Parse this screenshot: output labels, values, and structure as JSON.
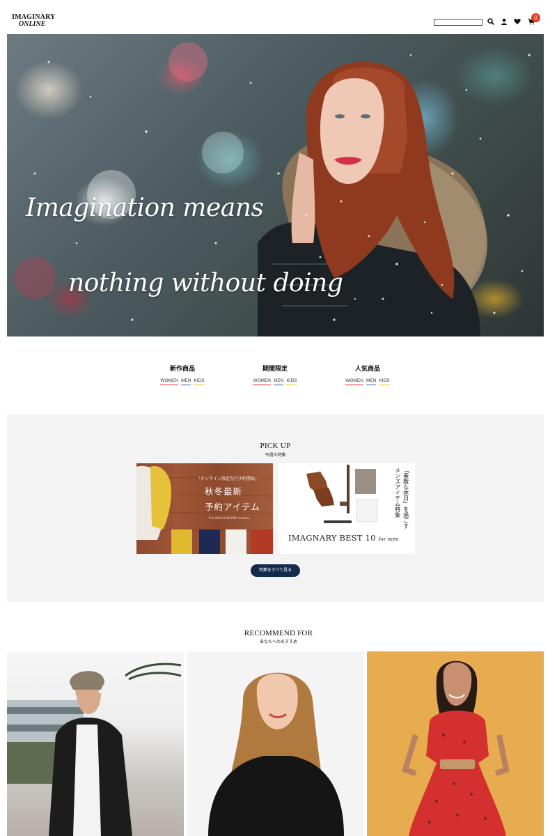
{
  "header": {
    "logo_top": "IMAGINARY",
    "logo_bottom": "ONLINE",
    "search_placeholder": "",
    "icons": [
      "search-icon",
      "user-icon",
      "heart-icon",
      "cart-icon"
    ],
    "cart_count": "0"
  },
  "hero": {
    "line1": "Imagination means",
    "line2": "nothing without doing"
  },
  "categories": [
    {
      "title": "新作商品",
      "links": [
        "WOMEN",
        "MEN",
        "KIDS"
      ]
    },
    {
      "title": "期間限定",
      "links": [
        "WOMEN",
        "MEN",
        "KIDS"
      ]
    },
    {
      "title": "人気商品",
      "links": [
        "WOMEN",
        "MEN",
        "KIDS"
      ]
    }
  ],
  "pickup": {
    "title": "PICK UP",
    "subtitle": "今週の特集",
    "banner1": {
      "small": "「オンライン限定先行予約開始」",
      "line1": "秋冬最新",
      "line2": "予約アイテム",
      "tiny": "For IMAGINARY women"
    },
    "banner2": {
      "caption_main": "IMAGNARY BEST 10",
      "caption_small": "for men",
      "vertical1": "「素敵な休日」を過ごす",
      "vertical2": "メンズアイテム特集"
    },
    "button_label": "特集をすべて見る"
  },
  "recommend": {
    "title": "RECOMMEND FOR",
    "subtitle": "あなたへのおすすめ"
  },
  "colors": {
    "cart_badge": "#e23a1d",
    "button_navy": "#132a4c",
    "women_underline": "#dd2222",
    "men_underline": "#2b5fb5",
    "kids_underline": "#e6c41a",
    "pickup_bg": "#f3f3f3"
  }
}
